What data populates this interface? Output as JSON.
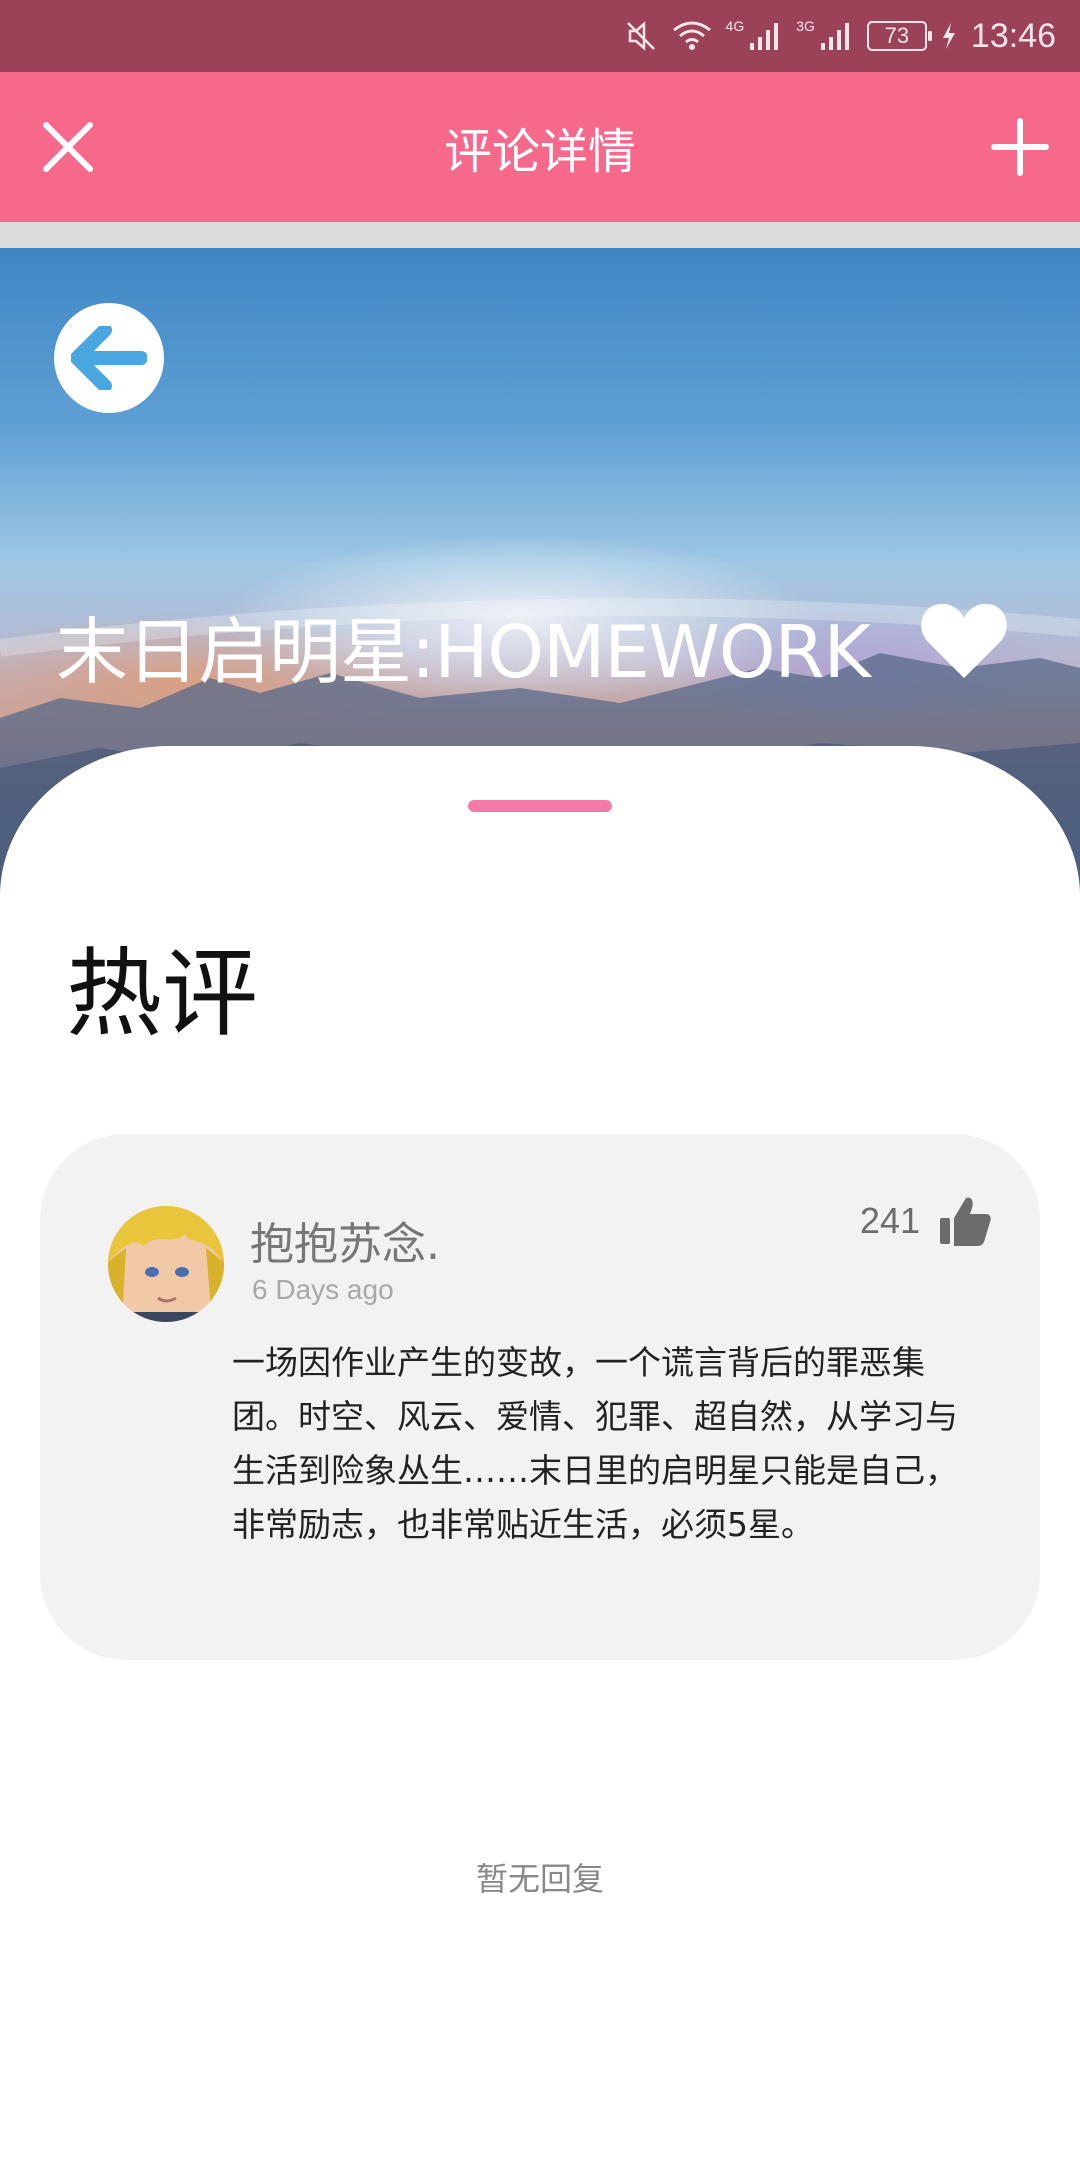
{
  "status_bar": {
    "network_1": "4G",
    "network_2": "3G",
    "battery": "73",
    "time": "13:46",
    "icons": [
      "mute-icon",
      "wifi-icon",
      "signal-icon",
      "signal-icon",
      "battery-icon",
      "charging-icon"
    ]
  },
  "toolbar": {
    "title": "评论详情",
    "close_icon": "close-icon",
    "add_icon": "plus-icon",
    "color": "#f7698b"
  },
  "hero": {
    "title": "末日启明星:HOMEWORK",
    "back_icon": "arrow-left-icon",
    "favorite_icon": "heart-icon"
  },
  "section": {
    "title": "热评"
  },
  "comment": {
    "username": "抱抱苏念.",
    "time": "6 Days ago",
    "likes": "241",
    "like_icon": "thumbs-up-icon",
    "text": "一场因作业产生的变故，一个谎言背后的罪恶集团。时空、风云、爱情、犯罪、超自然，从学习与生活到险象丛生……末日里的启明星只能是自己，非常励志，也非常贴近生活，必须5星。"
  },
  "replies": {
    "empty_text": "暂无回复"
  }
}
